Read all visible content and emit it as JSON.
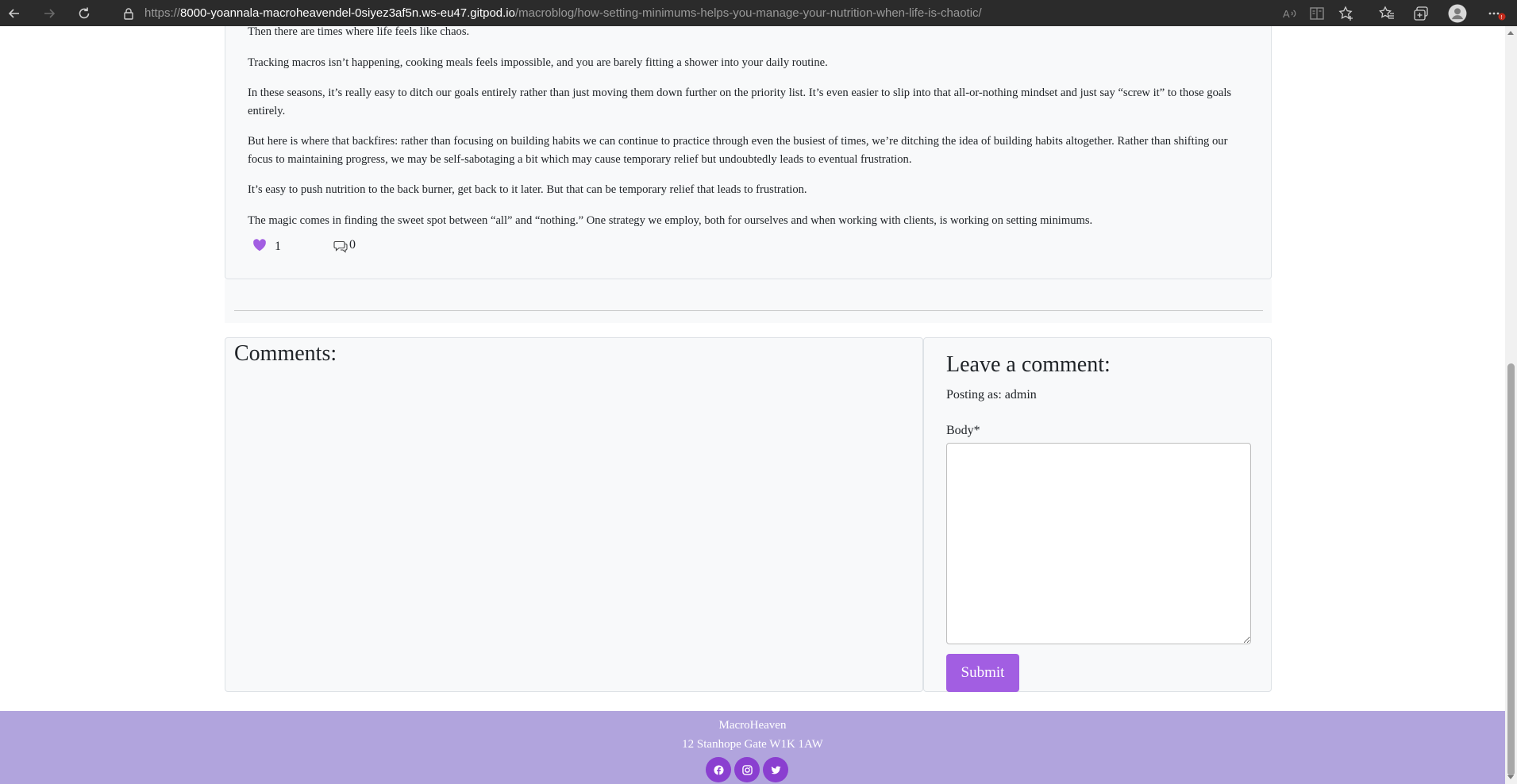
{
  "browser": {
    "url_scheme": "https://",
    "url_host": "8000-yoannala-macroheavendel-0siyez3af5n.ws-eu47.gitpod.io",
    "url_path": "/macroblog/how-setting-minimums-helps-you-manage-your-nutrition-when-life-is-chaotic/",
    "icons": [
      "back-icon",
      "forward-icon",
      "refresh-icon",
      "lock-icon",
      "read-aloud-icon",
      "reader-mode-icon",
      "add-favorite-icon",
      "favorites-icon",
      "collections-icon",
      "profile-icon",
      "more-icon"
    ]
  },
  "post": {
    "paragraphs": [
      "Then there are times where life feels like chaos.",
      "Tracking macros isn’t happening, cooking meals feels impossible, and you are barely fitting a shower into your daily routine.",
      "In these seasons, it’s really easy to ditch our goals entirely rather than just moving them down further on the priority list. It’s even easier to slip into that all-or-nothing mindset and just say “screw it” to those goals entirely.",
      "But here is where that backfires: rather than focusing on building habits we can continue to practice through even the busiest of times, we’re ditching the idea of building habits altogether. Rather than shifting our focus to maintaining progress, we may be self-sabotaging a bit which may cause temporary relief but undoubtedly leads to eventual frustration.",
      "It’s easy to push nutrition to the back burner, get back to it later. But that can be temporary relief that leads to frustration.",
      "The magic comes in finding the sweet spot between “all” and “nothing.” One strategy we employ, both for ourselves and when working with clients, is working on setting minimums."
    ],
    "likes": "1",
    "comments": "0",
    "like_color": "#a25ee2"
  },
  "comments_section": {
    "title": "Comments:"
  },
  "comment_form": {
    "title": "Leave a comment:",
    "posting_as": "Posting as: admin",
    "body_label": "Body*",
    "body_value": "",
    "submit_label": "Submit",
    "submit_color": "#a25ee2"
  },
  "footer": {
    "brand": "MacroHeaven",
    "address": "12 Stanhope Gate W1K 1AW",
    "background": "#b1a4dd",
    "social": [
      "facebook-icon",
      "instagram-icon",
      "twitter-icon"
    ]
  }
}
